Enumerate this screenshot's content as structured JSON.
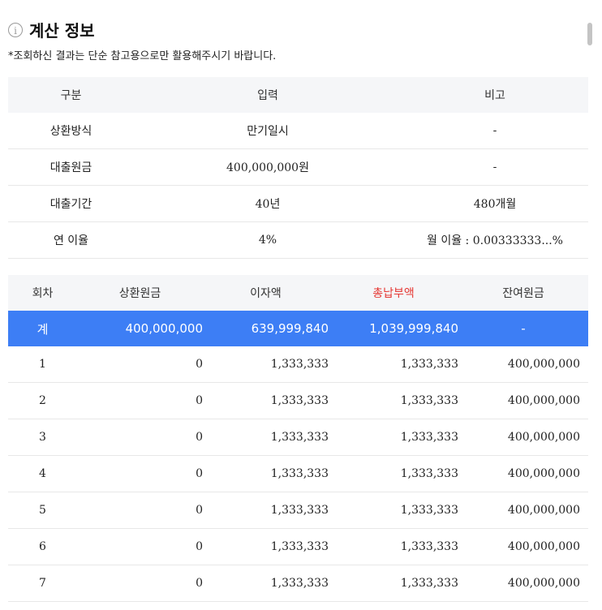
{
  "header": {
    "title": "계산 정보",
    "icon": "info-icon",
    "notice": "*조회하신 결과는 단순 참고용으로만 활용해주시기 바랍니다."
  },
  "summary": {
    "headers": [
      "구분",
      "입력",
      "비고"
    ],
    "rows": [
      [
        "상환방식",
        "만기일시",
        "-"
      ],
      [
        "대출원금",
        "400,000,000원",
        "-"
      ],
      [
        "대출기간",
        "40년",
        "480개월"
      ],
      [
        "연 이율",
        "4%",
        "월 이율 : 0.00333333...%"
      ]
    ]
  },
  "schedule": {
    "headers": [
      "회차",
      "상환원금",
      "이자액",
      "총납부액",
      "잔여원금"
    ],
    "total": [
      "계",
      "400,000,000",
      "639,999,840",
      "1,039,999,840",
      "-"
    ],
    "rows": [
      [
        "1",
        "0",
        "1,333,333",
        "1,333,333",
        "400,000,000"
      ],
      [
        "2",
        "0",
        "1,333,333",
        "1,333,333",
        "400,000,000"
      ],
      [
        "3",
        "0",
        "1,333,333",
        "1,333,333",
        "400,000,000"
      ],
      [
        "4",
        "0",
        "1,333,333",
        "1,333,333",
        "400,000,000"
      ],
      [
        "5",
        "0",
        "1,333,333",
        "1,333,333",
        "400,000,000"
      ],
      [
        "6",
        "0",
        "1,333,333",
        "1,333,333",
        "400,000,000"
      ],
      [
        "7",
        "0",
        "1,333,333",
        "1,333,333",
        "400,000,000"
      ]
    ]
  },
  "colors": {
    "accent": "#3d7ef5",
    "highlight_red": "#e53935",
    "header_bg": "#f5f6f8"
  }
}
